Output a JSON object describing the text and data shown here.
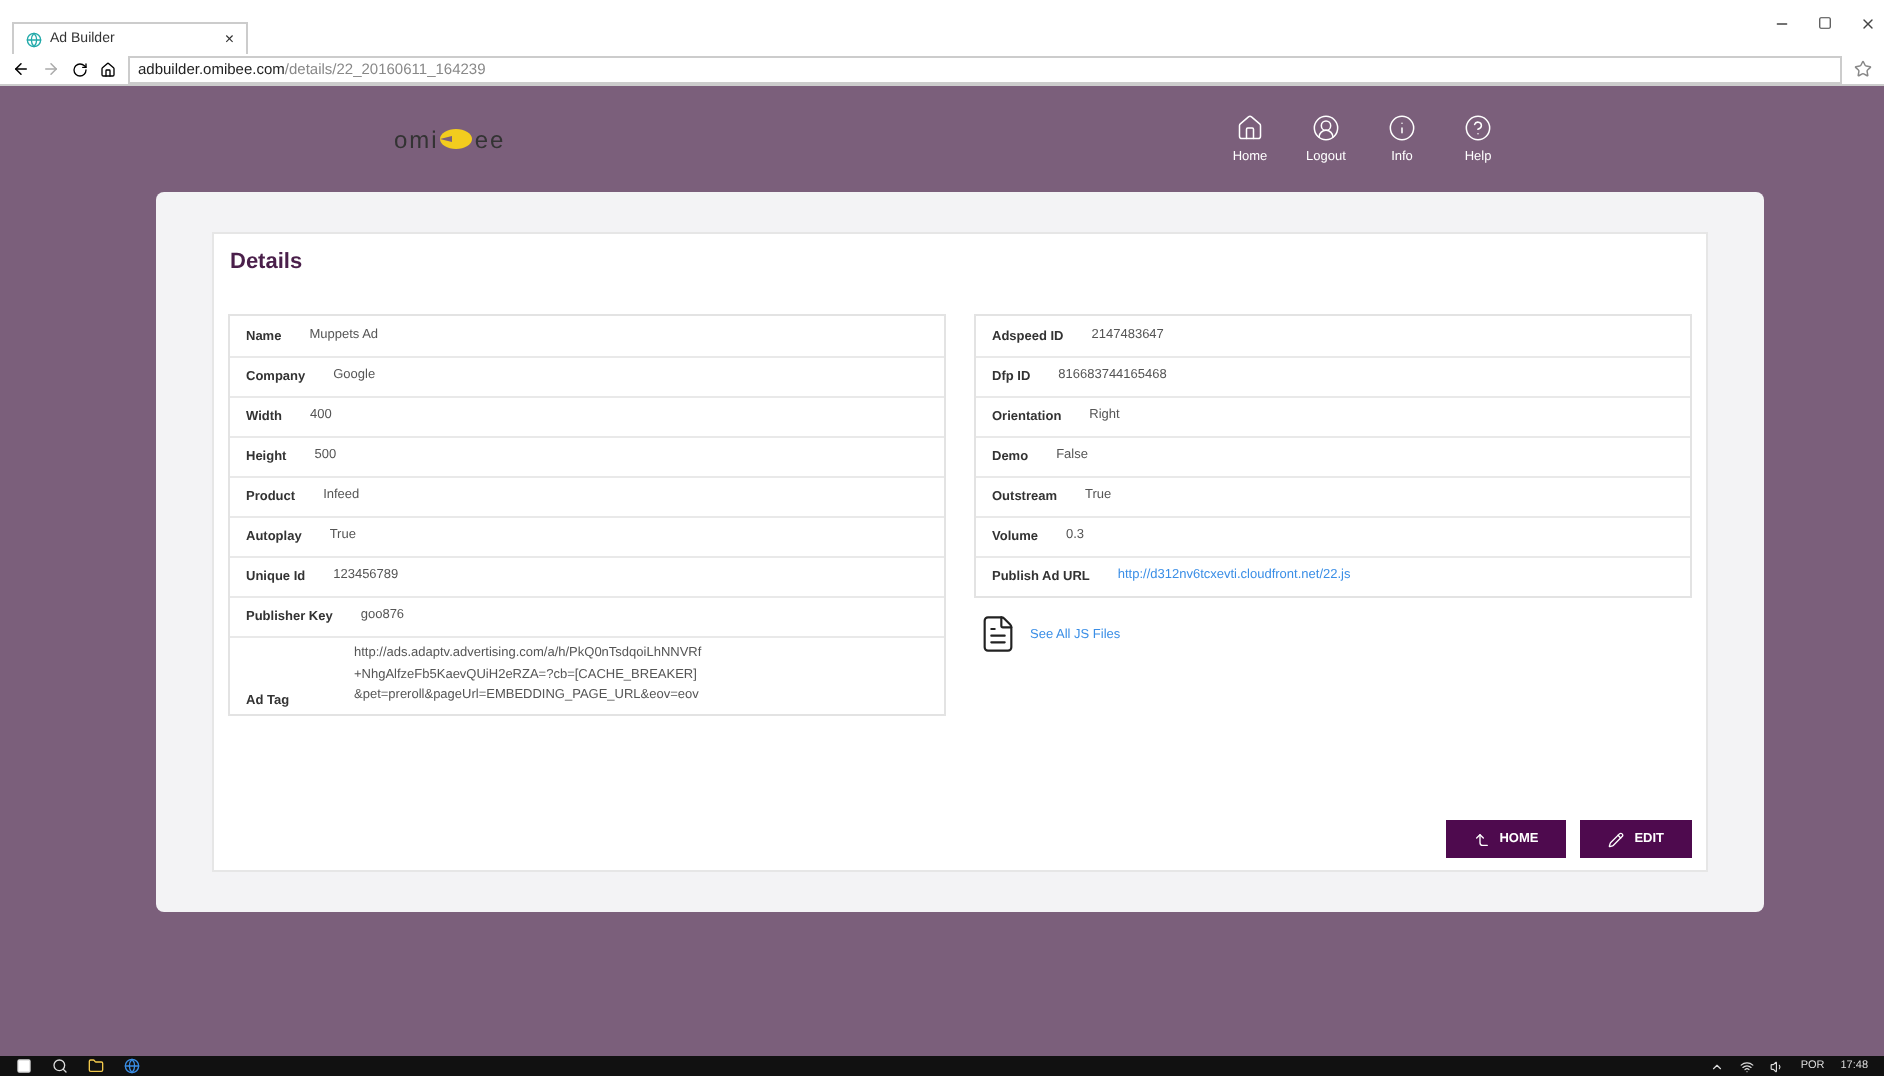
{
  "browser": {
    "tab_title": "Ad Builder",
    "tab_close": "×",
    "url_host": "adbuilder.omibee.com",
    "url_path": "/details/22_20160611_164239"
  },
  "header": {
    "logo_left": "omi",
    "logo_right": "ee",
    "nav": [
      {
        "label": "Home",
        "kind": "home"
      },
      {
        "label": "Logout",
        "kind": "user"
      },
      {
        "label": "Info",
        "kind": "info"
      },
      {
        "label": "Help",
        "kind": "help"
      }
    ]
  },
  "details": {
    "title": "Details",
    "left": [
      {
        "label": "Name",
        "value": "Muppets Ad"
      },
      {
        "label": "Company",
        "value": "Google"
      },
      {
        "label": "Width",
        "value": "400"
      },
      {
        "label": "Height",
        "value": "500"
      },
      {
        "label": "Product",
        "value": "Infeed"
      },
      {
        "label": "Autoplay",
        "value": "True"
      },
      {
        "label": "Unique Id",
        "value": "123456789"
      },
      {
        "label": "Publisher Key",
        "value": "goo876"
      },
      {
        "label": "Ad Tag",
        "value": "http://ads.adaptv.advertising.com/a/h/PkQ0nTsdqoiLhNNVRf+NhgAlfzeFb5KaevQUiH2eRZA=?cb=[CACHE_BREAKER]&pet=preroll&pageUrl=EMBEDDING_PAGE_URL&eov=eov",
        "kind": "long"
      }
    ],
    "right": [
      {
        "label": "Adspeed ID",
        "value": "2147483647"
      },
      {
        "label": "Dfp ID",
        "value": "816683744165468"
      },
      {
        "label": "Orientation",
        "value": "Right"
      },
      {
        "label": "Demo",
        "value": "False"
      },
      {
        "label": "Outstream",
        "value": "True"
      },
      {
        "label": "Volume",
        "value": "0.3"
      },
      {
        "label": "Publish Ad URL",
        "value": "http://d312nv6tcxevti.cloudfront.net/22.js",
        "kind": "link"
      }
    ],
    "files_link": "See All JS Files",
    "buttons": [
      {
        "label": "HOME",
        "kind": "home"
      },
      {
        "label": "EDIT",
        "kind": "edit"
      }
    ]
  },
  "taskbar": {
    "language": "POR",
    "time": "17:48"
  }
}
